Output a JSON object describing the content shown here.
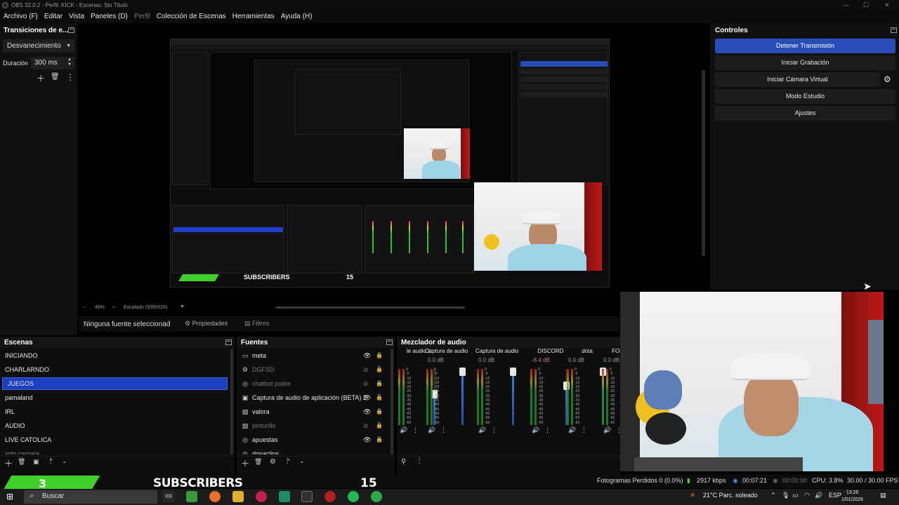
{
  "window": {
    "title": "OBS 32.0.2 - Perfil: KICK - Escenas: Sin Título"
  },
  "menu": [
    "Archivo (F)",
    "Editar",
    "Vista",
    "Paneles (D)",
    "Perfil",
    "Colección de Escenas",
    "Herramientas",
    "Ayuda (H)"
  ],
  "transitions": {
    "title": "Transiciones de e...",
    "selected": "Desvanecimiento",
    "duration_label": "Duración",
    "duration_value": "300 ms"
  },
  "preview": {
    "zoom": "48%",
    "scale_label": "Escalado (939x528)"
  },
  "context_bar": {
    "no_source": "Ninguna fuente seleccionad",
    "properties": "Propiedades",
    "filters": "Filtros"
  },
  "controls": {
    "title": "Controles",
    "buttons": [
      "Detener Transmisión",
      "Iniciar Grabación",
      "Iniciar Cámara Virtual",
      "Modo Estudio",
      "Ajustes"
    ]
  },
  "scenes": {
    "title": "Escenas",
    "items": [
      "INICIANDO",
      "CHARLARNDO",
      "JUEGOS",
      "pamaland",
      "IRL",
      "AUDIO",
      "LIVE CATOLICA",
      "solo camara"
    ],
    "selected": "JUEGOS"
  },
  "sources": {
    "title": "Fuentes",
    "items": [
      {
        "name": "meta",
        "icon": "window-icon",
        "visible": true
      },
      {
        "name": "DGFSD",
        "icon": "gear-icon",
        "visible": false
      },
      {
        "name": "chatbot pobre",
        "icon": "globe-icon",
        "visible": false
      },
      {
        "name": "Captura de audio de aplicación (BETA) 2",
        "icon": "audio-icon",
        "visible": true
      },
      {
        "name": "valora",
        "icon": "image-icon",
        "visible": true
      },
      {
        "name": "pinturillo",
        "icon": "image-icon",
        "visible": false
      },
      {
        "name": "apuestas",
        "icon": "globe-icon",
        "visible": true
      },
      {
        "name": "donaclips",
        "icon": "globe-icon",
        "visible": true
      }
    ]
  },
  "mixer": {
    "title": "Mezclador de audio",
    "channels": [
      {
        "name": "le audio c",
        "db": "",
        "level": 0.55
      },
      {
        "name": "Captura de audio c",
        "db": "0.0 dB",
        "level": 0.95
      },
      {
        "name": "Captura de audio c",
        "db": "0.0 dB",
        "level": 0.95
      },
      {
        "name": "DISCORD",
        "db": "-8.4 dB",
        "level": 0.7
      },
      {
        "name": "dota",
        "db": "0.0 dB",
        "level": 0.95
      },
      {
        "name": "FORTNI",
        "db": "0.0 dB",
        "level": 0.95
      }
    ],
    "scale": [
      "0",
      "-5",
      "-10",
      "-15",
      "-20",
      "-25",
      "-30",
      "-35",
      "-40",
      "-45",
      "-50",
      "-55",
      "-60"
    ]
  },
  "status": {
    "dropped": "Fotogramas Perdidos 0 (0.0%)",
    "bitrate": "2917 kbps",
    "stream_time": "00:07:21",
    "rec_time": "00:00:00",
    "cpu": "CPU: 3.8%",
    "fps": "30.00 / 30.00 FPS"
  },
  "overlay": {
    "sub_count": "3",
    "sub_label": "SUBSCRIBERS",
    "sub_goal": "15"
  },
  "taskbar": {
    "search": "Buscar",
    "weather": "21°C  Parc. soleado",
    "lang": "ESP",
    "time": "13:26",
    "date": "1/01/2026"
  },
  "colors": {
    "accent": "#284cb8",
    "selection": "#1c3ec0",
    "sub_green": "#3fd02b",
    "panel_bg": "#0e0e0e"
  }
}
